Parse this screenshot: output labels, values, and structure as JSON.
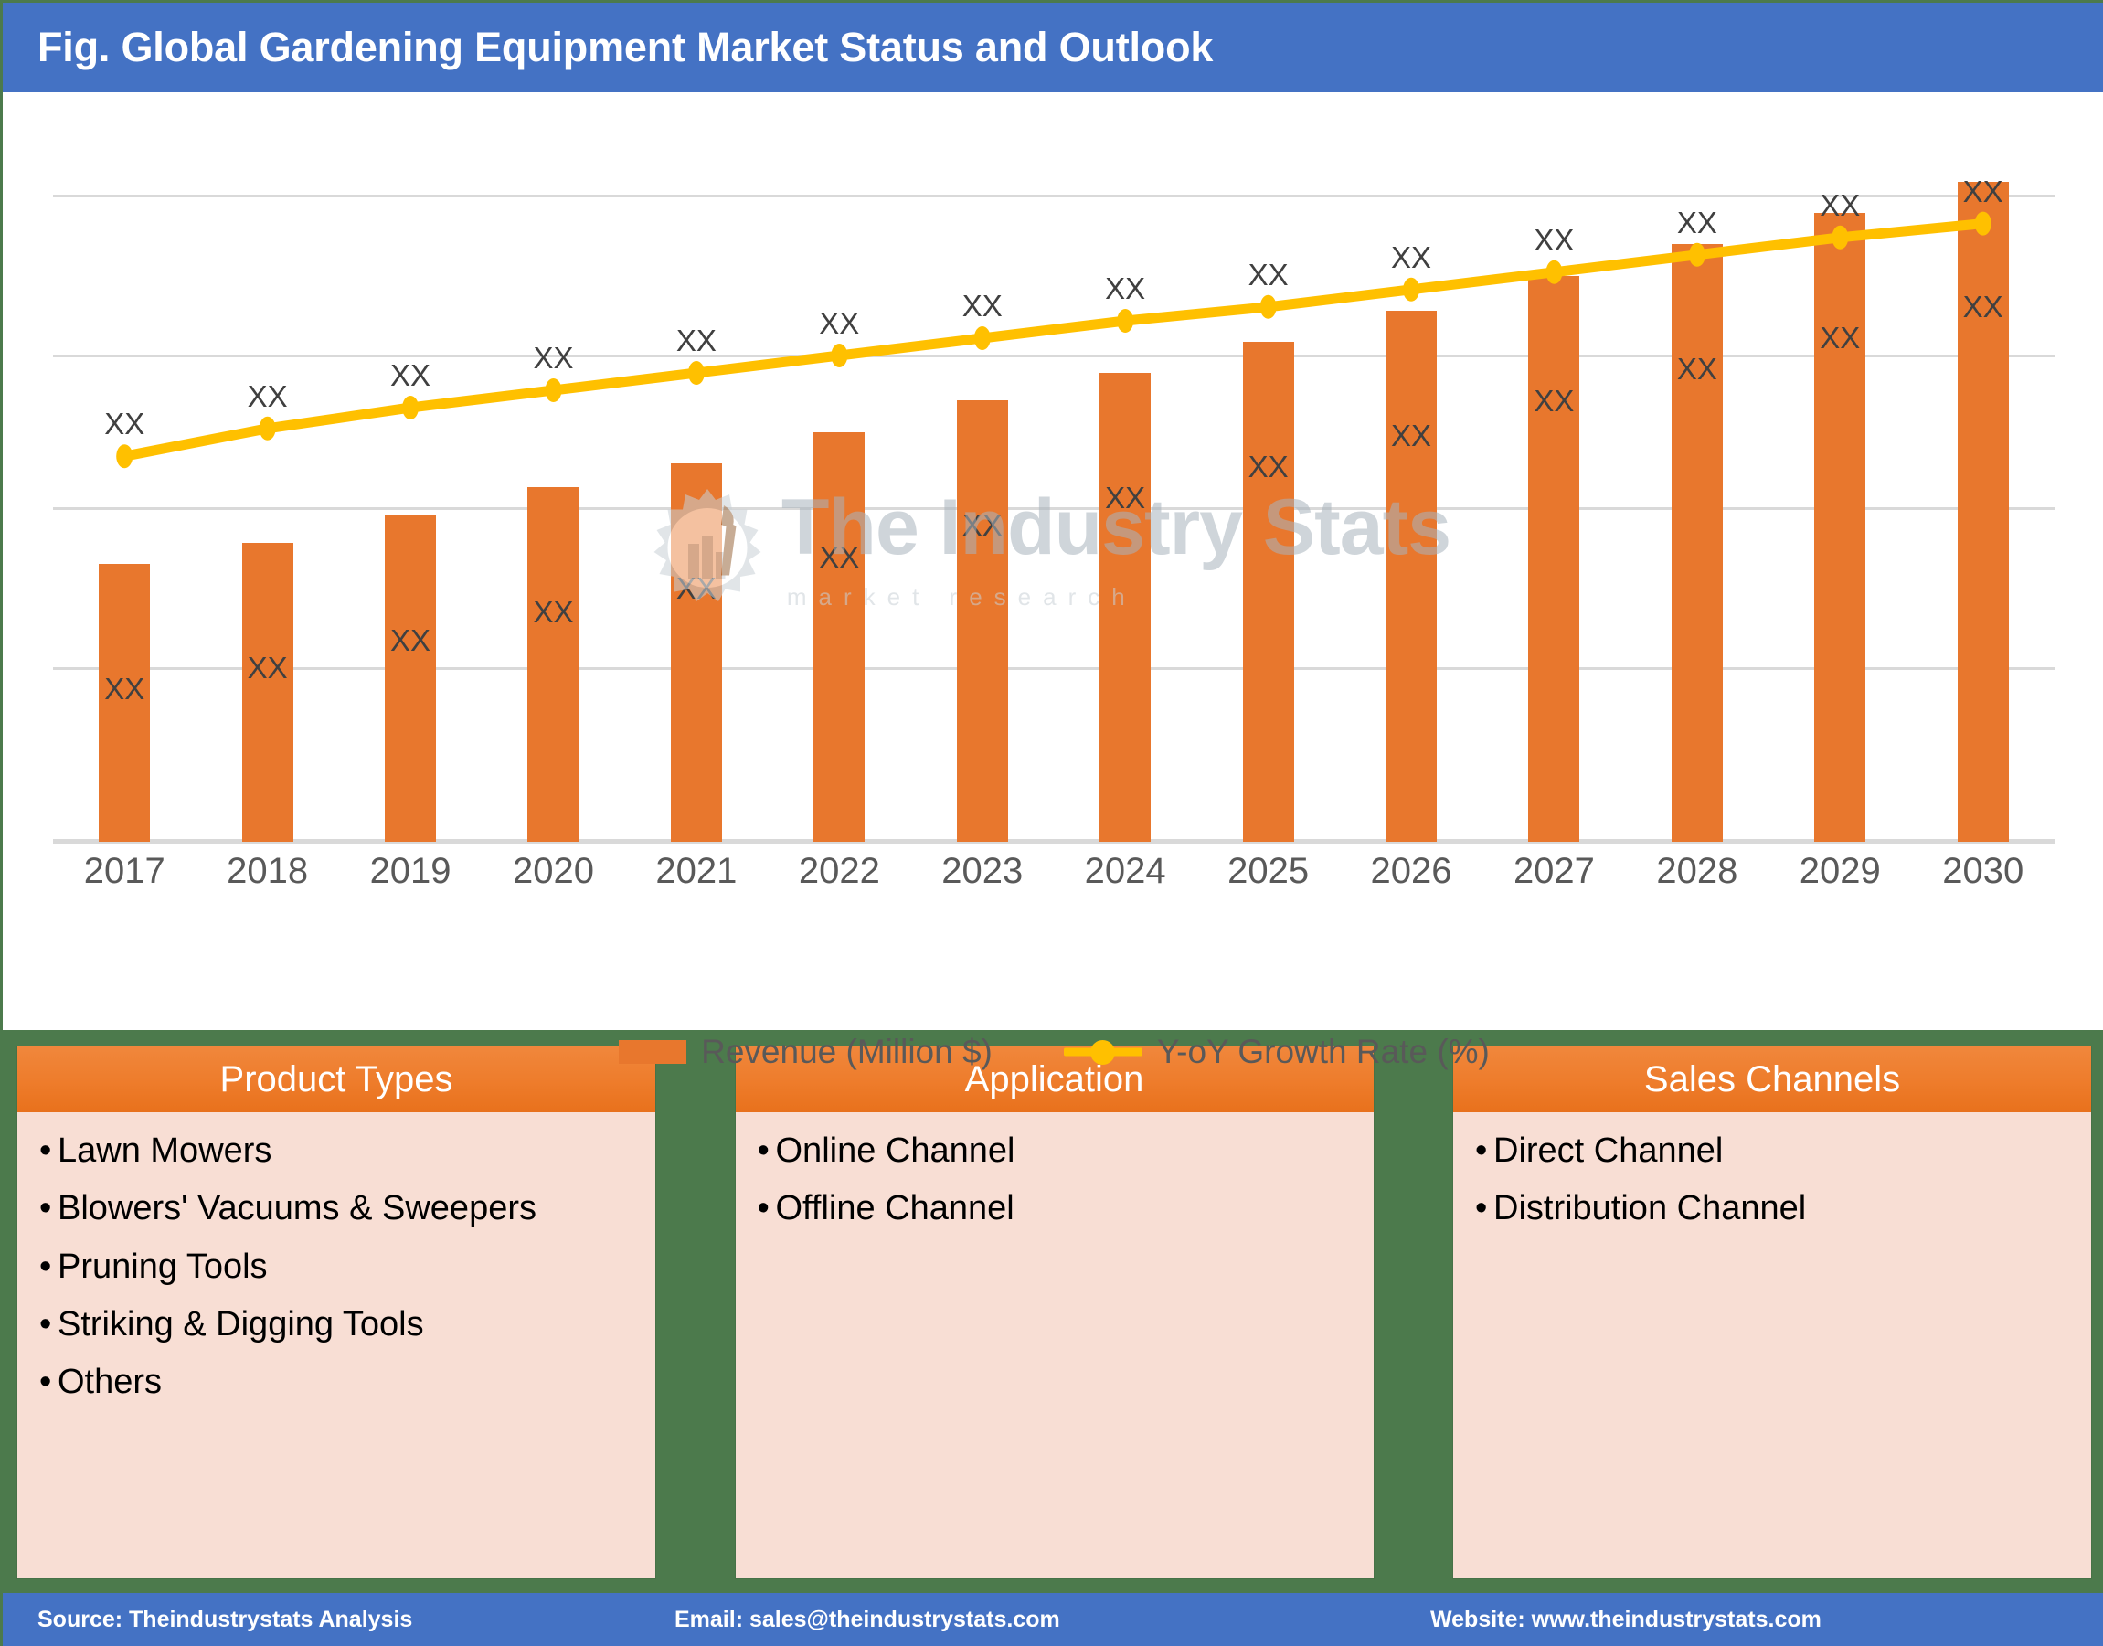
{
  "header": {
    "title": "Fig. Global Gardening Equipment Market Status and Outlook"
  },
  "watermark": {
    "main": "The Industry Stats",
    "sub": "market research",
    "icon": "gear-factory-icon"
  },
  "legend": {
    "items": [
      {
        "label": "Revenue (Million $)",
        "color": "#E8772D",
        "marker": "bar-swatch"
      },
      {
        "label": "Y-oY Growth Rate (%)",
        "color": "#FFC000",
        "marker": "line-dot"
      }
    ]
  },
  "chart_data": {
    "type": "bar",
    "title": "Fig. Global Gardening Equipment Market Status and Outlook",
    "xlabel": "",
    "ylabel": "",
    "grid": true,
    "legend_position": "bottom",
    "categories": [
      "2017",
      "2018",
      "2019",
      "2020",
      "2021",
      "2022",
      "2023",
      "2024",
      "2025",
      "2026",
      "2027",
      "2028",
      "2029",
      "2030"
    ],
    "ylim": [
      0,
      100
    ],
    "series": [
      {
        "name": "Revenue (Million $)",
        "type": "bar",
        "color": "#E8772D",
        "axis": "left",
        "values": [
          40.0,
          43.0,
          47.0,
          51.0,
          54.5,
          59.0,
          63.5,
          67.5,
          72.0,
          76.5,
          81.5,
          86.0,
          90.5,
          95.0
        ],
        "data_labels": [
          "XX",
          "XX",
          "XX",
          "XX",
          "XX",
          "XX",
          "XX",
          "XX",
          "XX",
          "XX",
          "XX",
          "XX",
          "XX",
          "XX"
        ]
      },
      {
        "name": "Y-oY Growth Rate (%)",
        "type": "line",
        "color": "#FFC000",
        "axis": "right",
        "values": [
          55.5,
          59.5,
          62.5,
          65.0,
          67.5,
          70.0,
          72.5,
          75.0,
          77.0,
          79.5,
          82.0,
          84.5,
          87.0,
          89.0
        ],
        "data_labels": [
          "XX",
          "XX",
          "XX",
          "XX",
          "XX",
          "XX",
          "XX",
          "XX",
          "XX",
          "XX",
          "XX",
          "XX",
          "XX",
          "XX"
        ]
      }
    ],
    "gridline_levels": [
      93.0,
      70.0,
      48.0,
      25.0,
      0.0
    ]
  },
  "panels": [
    {
      "title": "Product Types",
      "items": [
        "Lawn Mowers",
        "Blowers' Vacuums & Sweepers",
        "Pruning Tools",
        "Striking & Digging Tools",
        "Others"
      ]
    },
    {
      "title": "Application",
      "items": [
        "Online Channel",
        "Offline Channel"
      ]
    },
    {
      "title": "Sales Channels",
      "items": [
        "Direct Channel",
        "Distribution Channel"
      ]
    }
  ],
  "footer": {
    "source": "Source: Theindustrystats Analysis",
    "email": "Email: sales@theindustrystats.com",
    "website": "Website: www.theindustrystats.com"
  },
  "colors": {
    "header_blue": "#4472C4",
    "bar_orange": "#E8772D",
    "line_yellow": "#FFC000",
    "panel_green": "#4C7A4C",
    "panel_body_pink": "#F8DED4",
    "panel_head_orange": "#EE7C2B",
    "gridline_gray": "#D9D9D9",
    "tick_gray": "#595959"
  }
}
